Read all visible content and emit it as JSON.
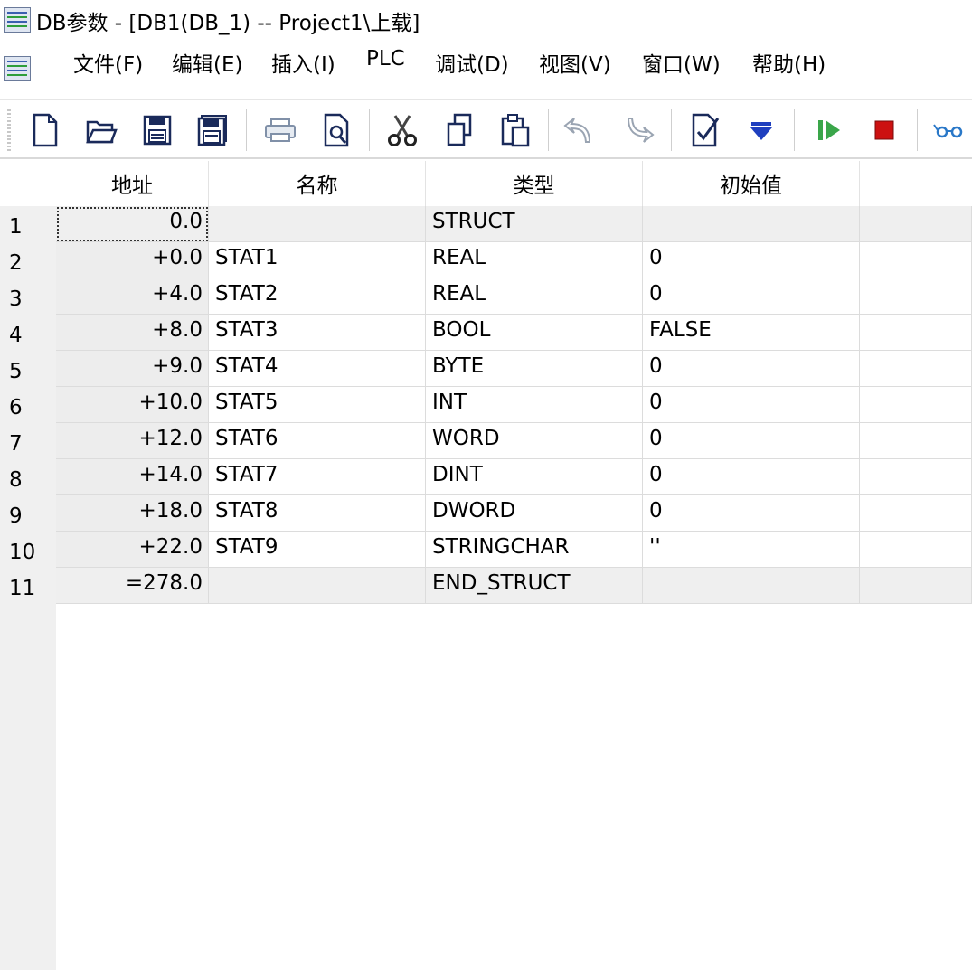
{
  "window": {
    "title": "DB参数 - [DB1(DB_1) -- Project1\\上载]"
  },
  "menu": [
    {
      "label": "文件(F)"
    },
    {
      "label": "编辑(E)"
    },
    {
      "label": "插入(I)"
    },
    {
      "label": "PLC"
    },
    {
      "label": "调试(D)"
    },
    {
      "label": "视图(V)"
    },
    {
      "label": "窗口(W)"
    },
    {
      "label": "帮助(H)"
    }
  ],
  "toolbar": {
    "icons": [
      "new-icon",
      "open-icon",
      "save-icon",
      "save-all-icon",
      "print-icon",
      "print-preview-icon",
      "cut-icon",
      "copy-icon",
      "paste-icon",
      "undo-icon",
      "redo-icon",
      "check-icon",
      "download-icon",
      "run-icon",
      "stop-icon",
      "monitor-icon"
    ],
    "colors": {
      "run": "#3aa64a",
      "stop": "#cc1111",
      "download": "#1f3fbf",
      "monitor": "#2a78c8"
    }
  },
  "table": {
    "columns": [
      "地址",
      "名称",
      "类型",
      "初始值"
    ],
    "rows": [
      {
        "num": "1",
        "address": "0.0",
        "name": "",
        "type": "STRUCT",
        "initial": ""
      },
      {
        "num": "2",
        "address": "+0.0",
        "name": "STAT1",
        "type": "REAL",
        "initial": "0"
      },
      {
        "num": "3",
        "address": "+4.0",
        "name": "STAT2",
        "type": "REAL",
        "initial": "0"
      },
      {
        "num": "4",
        "address": "+8.0",
        "name": "STAT3",
        "type": "BOOL",
        "initial": "FALSE"
      },
      {
        "num": "5",
        "address": "+9.0",
        "name": "STAT4",
        "type": "BYTE",
        "initial": "0"
      },
      {
        "num": "6",
        "address": "+10.0",
        "name": "STAT5",
        "type": "INT",
        "initial": "0"
      },
      {
        "num": "7",
        "address": "+12.0",
        "name": "STAT6",
        "type": "WORD",
        "initial": "0"
      },
      {
        "num": "8",
        "address": "+14.0",
        "name": "STAT7",
        "type": "DINT",
        "initial": "0"
      },
      {
        "num": "9",
        "address": "+18.0",
        "name": "STAT8",
        "type": "DWORD",
        "initial": "0"
      },
      {
        "num": "10",
        "address": "+22.0",
        "name": "STAT9",
        "type": "STRINGCHAR",
        "initial": "''"
      },
      {
        "num": "11",
        "address": "=278.0",
        "name": "",
        "type": "END_STRUCT",
        "initial": ""
      }
    ]
  }
}
